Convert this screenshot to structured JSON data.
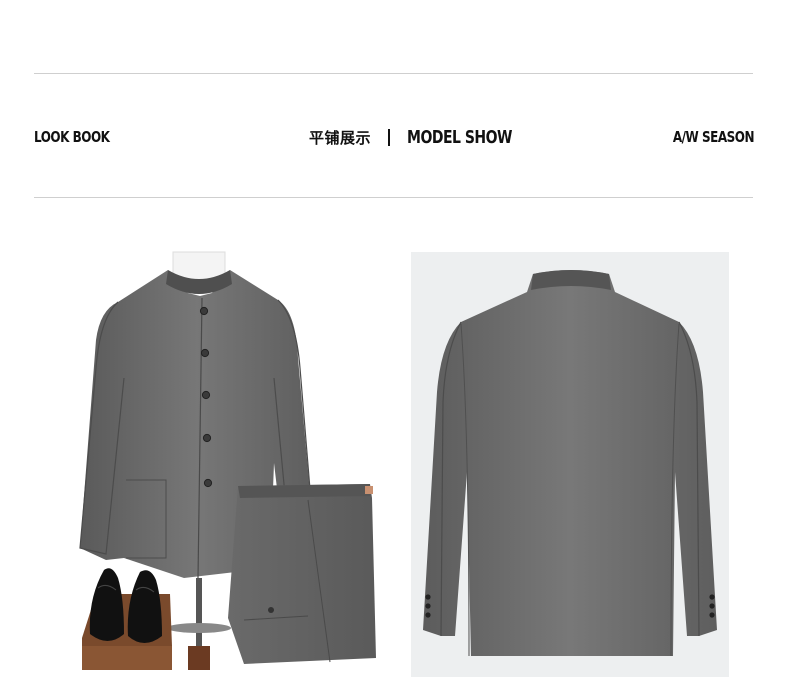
{
  "header": {
    "left_label": "LOOK BOOK",
    "title_cn": "平铺展示",
    "title_en": "MODEL SHOW",
    "right_label": "A/W SEASON"
  },
  "images": [
    {
      "name": "front-suit-flatlay",
      "description": "gray mandarin-collar suit jacket, folded trousers, black shoes"
    },
    {
      "name": "back-view-jacket"
    }
  ],
  "colors": {
    "suit_gray": "#6b6b6b",
    "rule": "#cfcfcf",
    "text": "#111111",
    "back_bg": "#edeff0"
  }
}
